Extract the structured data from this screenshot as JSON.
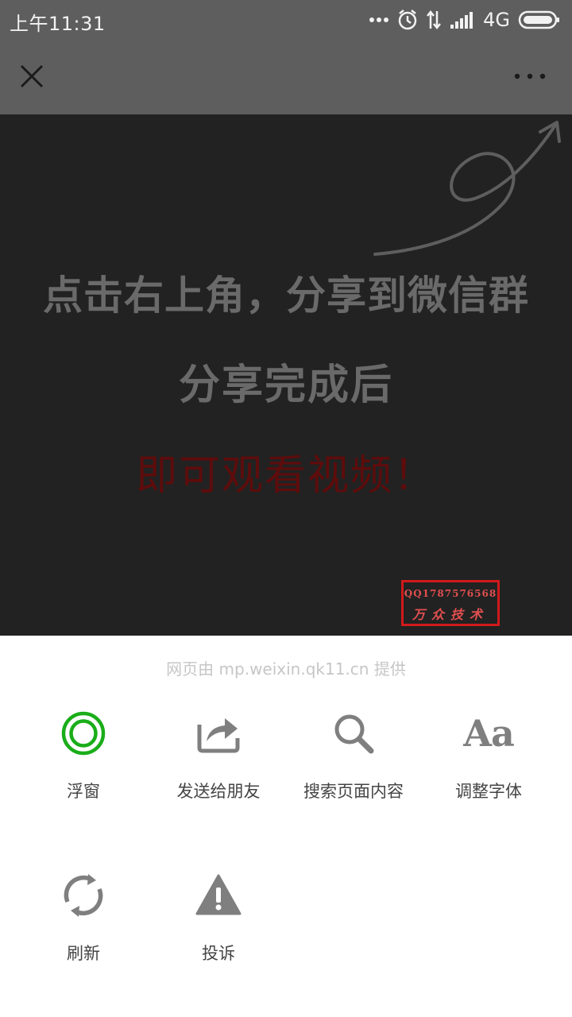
{
  "status_bar": {
    "time": "上午11:31",
    "network": "4G"
  },
  "title_bar": {
    "close_icon": "close-icon",
    "more_icon": "more-icon"
  },
  "page": {
    "line1": "点击右上角，分享到微信群",
    "line2": "分享完成后",
    "line3": "即可观看视频！",
    "watermark_line1": "QQ1787576568",
    "watermark_line2": "万众技术",
    "colors": {
      "background": "#222222",
      "text": "#6a6a6a",
      "highlight": "#5e0c0c",
      "watermark": "#d11a1a"
    }
  },
  "sheet": {
    "provider": "网页由 mp.weixin.qk11.cn 提供",
    "actions": [
      {
        "label": "浮窗",
        "icon": "float-window-icon"
      },
      {
        "label": "发送给朋友",
        "icon": "share-icon"
      },
      {
        "label": "搜索页面内容",
        "icon": "search-icon"
      },
      {
        "label": "调整字体",
        "icon": "font-icon"
      },
      {
        "label": "刷新",
        "icon": "refresh-icon"
      },
      {
        "label": "投诉",
        "icon": "warning-icon"
      }
    ],
    "colors": {
      "accent": "#1aad19",
      "icon": "#7f7f7f"
    }
  }
}
